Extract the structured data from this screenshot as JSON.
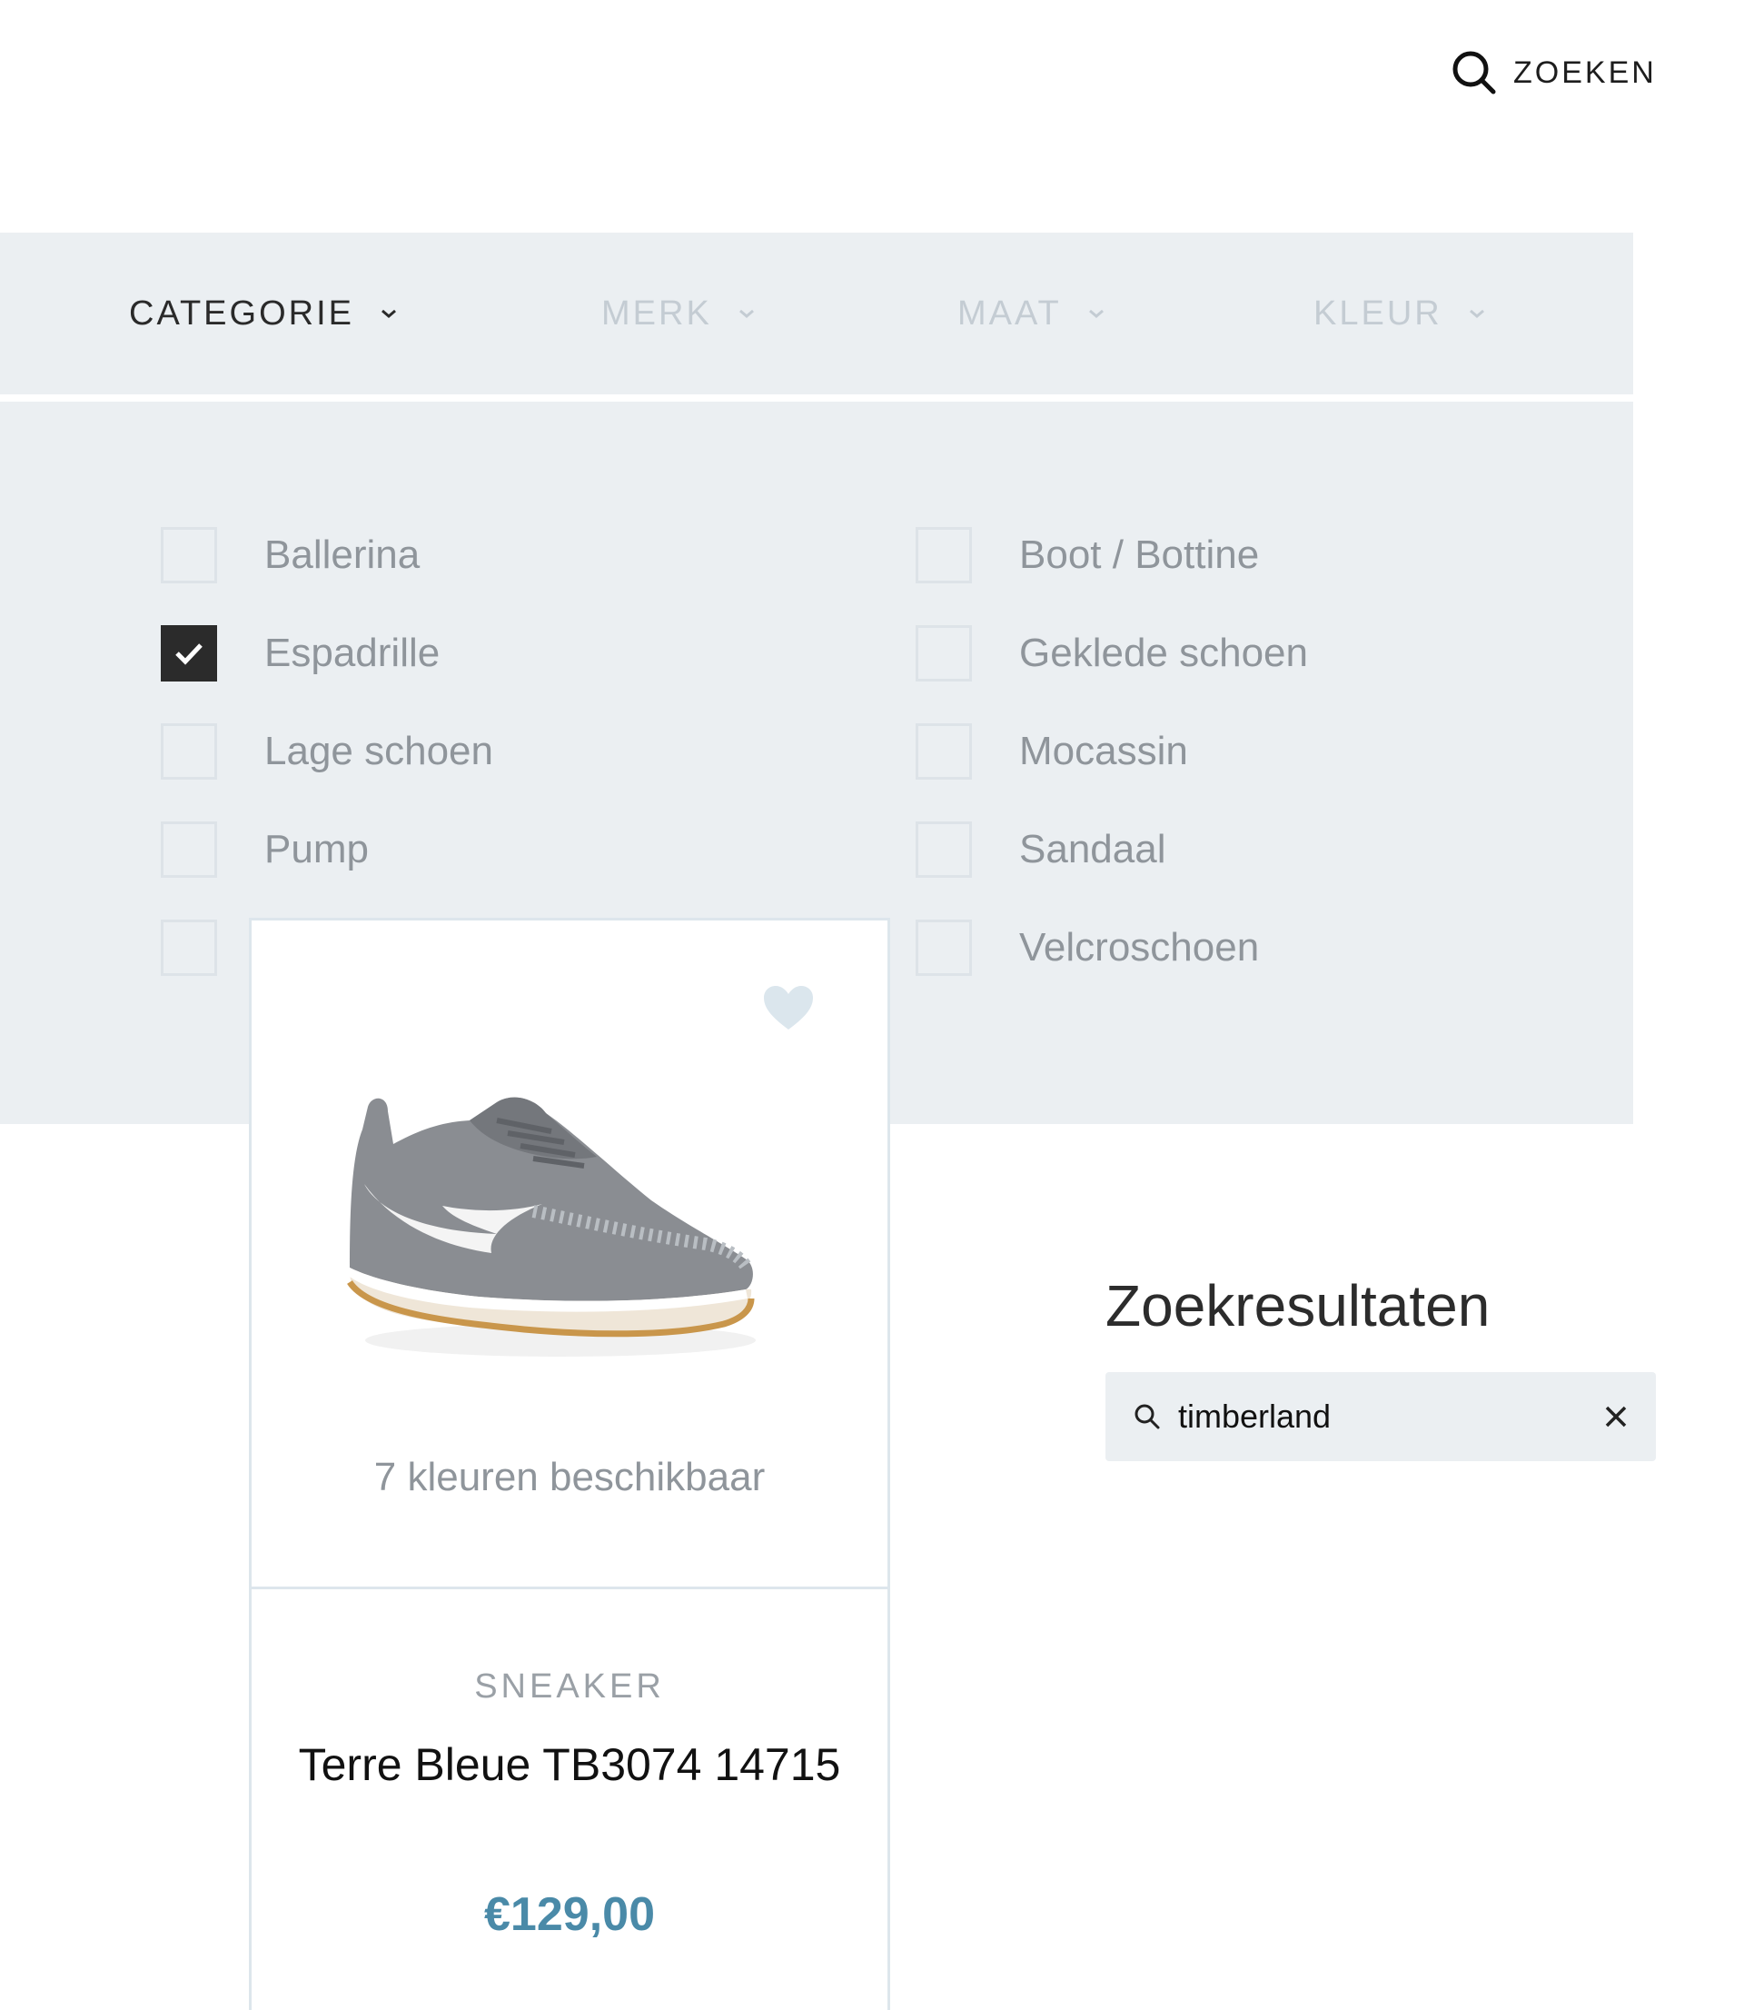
{
  "header": {
    "search_label": "ZOEKEN"
  },
  "filters": {
    "tabs": [
      {
        "label": "CATEGORIE",
        "active": true
      },
      {
        "label": "MERK",
        "active": false
      },
      {
        "label": "MAAT",
        "active": false
      },
      {
        "label": "KLEUR",
        "active": false
      }
    ],
    "categories": [
      {
        "label": "Ballerina",
        "checked": false
      },
      {
        "label": "Boot / Bottine",
        "checked": false
      },
      {
        "label": "Espadrille",
        "checked": true
      },
      {
        "label": "Geklede schoen",
        "checked": false
      },
      {
        "label": "Lage schoen",
        "checked": false
      },
      {
        "label": "Mocassin",
        "checked": false
      },
      {
        "label": "Pump",
        "checked": false
      },
      {
        "label": "Sandaal",
        "checked": false
      },
      {
        "label": "",
        "checked": false
      },
      {
        "label": "Velcroschoen",
        "checked": false
      }
    ]
  },
  "product": {
    "colors_available": "7 kleuren beschikbaar",
    "category": "SNEAKER",
    "name": "Terre Bleue TB3074 14715",
    "price": "€129,00"
  },
  "results": {
    "title": "Zoekresultaten",
    "search_value": "timberland"
  },
  "colors": {
    "panel_bg": "#ebeff2",
    "price": "#4a8aa8",
    "checkbox_checked": "#2b2b2b",
    "inactive_tab": "#c4ccd3"
  }
}
